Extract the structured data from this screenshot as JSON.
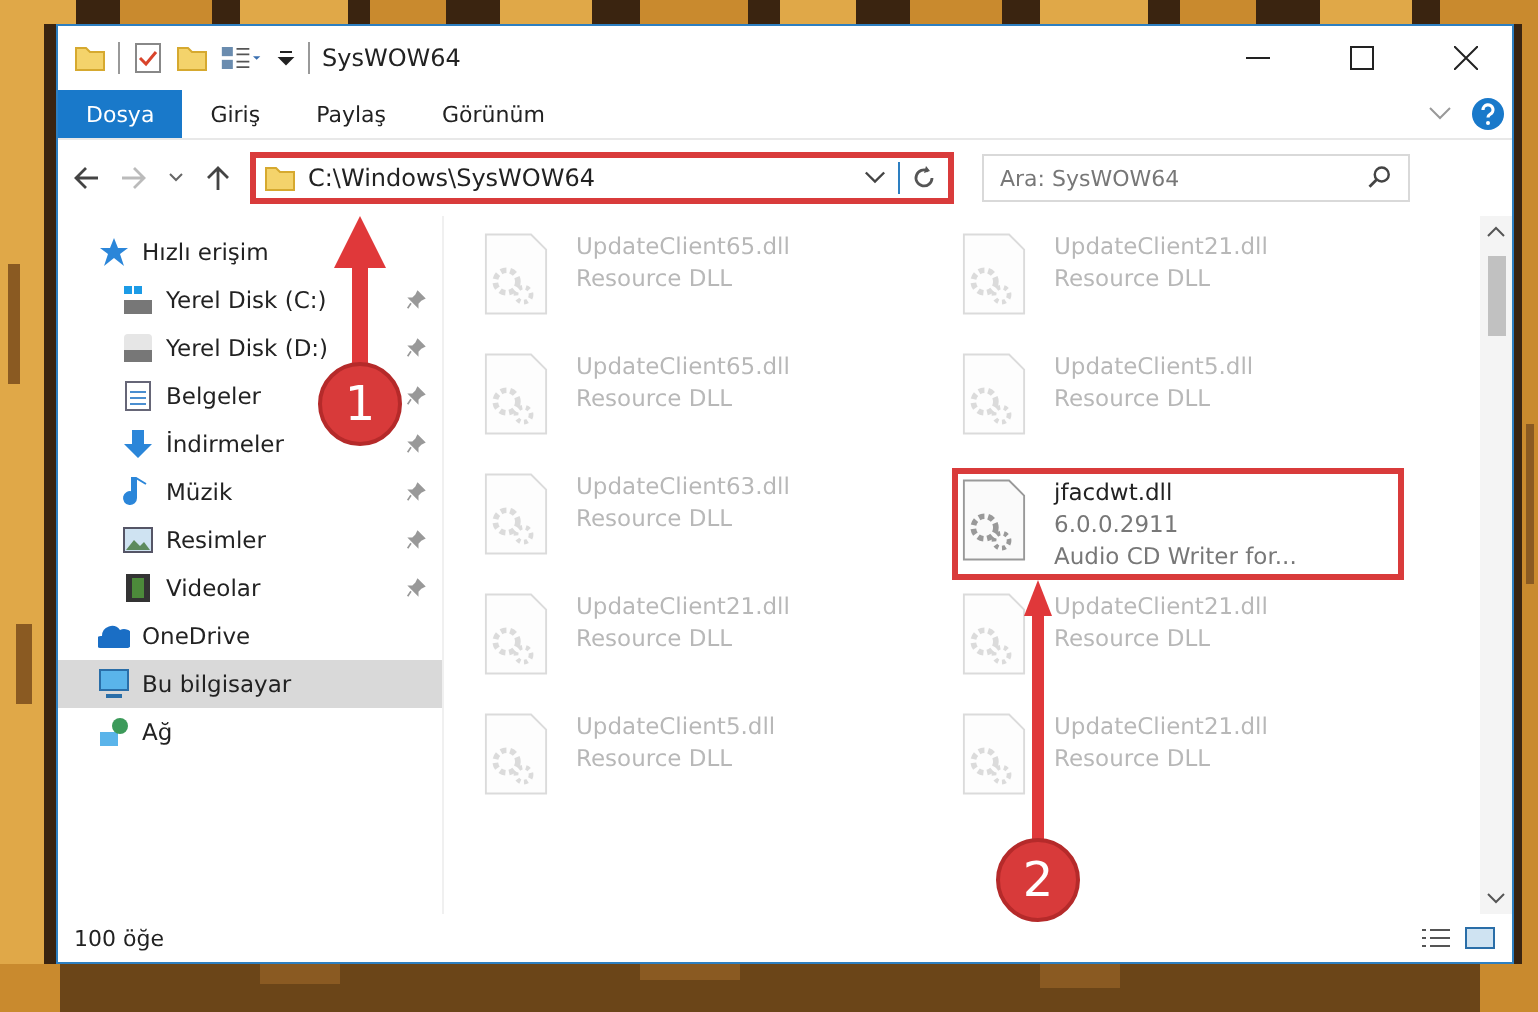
{
  "window": {
    "title": "SysWOW64"
  },
  "ribbon_tabs": [
    {
      "label": "Dosya",
      "selected": true
    },
    {
      "label": "Giriş",
      "selected": false
    },
    {
      "label": "Paylaş",
      "selected": false
    },
    {
      "label": "Görünüm",
      "selected": false
    }
  ],
  "address_bar": {
    "path": "C:\\Windows\\SysWOW64",
    "highlighted": true
  },
  "search": {
    "placeholder": "Ara: SysWOW64"
  },
  "sidebar": {
    "items": [
      {
        "label": "Hızlı erişim",
        "selected": false,
        "children": [
          {
            "label": "Yerel Disk (C:)",
            "pinned": true
          },
          {
            "label": "Yerel Disk (D:)",
            "pinned": true
          },
          {
            "label": "Belgeler",
            "pinned": true
          },
          {
            "label": "İndirmeler",
            "pinned": true
          },
          {
            "label": "Müzik",
            "pinned": true
          },
          {
            "label": "Resimler",
            "pinned": true
          },
          {
            "label": "Videolar",
            "pinned": true
          }
        ]
      },
      {
        "label": "OneDrive",
        "selected": false
      },
      {
        "label": "Bu bilgisayar",
        "selected": true
      },
      {
        "label": "Ağ",
        "selected": false
      }
    ]
  },
  "files": [
    {
      "name": "UpdateClient65.dll",
      "lines": [
        "Resource DLL"
      ],
      "faded": true,
      "highlighted": false
    },
    {
      "name": "UpdateClient21.dll",
      "lines": [
        "Resource DLL"
      ],
      "faded": true,
      "highlighted": false
    },
    {
      "name": "UpdateClient65.dll",
      "lines": [
        "Resource DLL"
      ],
      "faded": true,
      "highlighted": false
    },
    {
      "name": "UpdateClient5.dll",
      "lines": [
        "Resource DLL"
      ],
      "faded": true,
      "highlighted": false
    },
    {
      "name": "UpdateClient63.dll",
      "lines": [
        "Resource DLL"
      ],
      "faded": true,
      "highlighted": false
    },
    {
      "name": "jfacdwt.dll",
      "lines": [
        "6.0.0.2911",
        "Audio CD Writer for..."
      ],
      "faded": false,
      "highlighted": true
    },
    {
      "name": "UpdateClient21.dll",
      "lines": [
        "Resource DLL"
      ],
      "faded": true,
      "highlighted": false
    },
    {
      "name": "UpdateClient21.dll",
      "lines": [
        "Resource DLL"
      ],
      "faded": true,
      "highlighted": false
    },
    {
      "name": "UpdateClient5.dll",
      "lines": [
        "Resource DLL"
      ],
      "faded": true,
      "highlighted": false
    },
    {
      "name": "UpdateClient21.dll",
      "lines": [
        "Resource DLL"
      ],
      "faded": true,
      "highlighted": false
    }
  ],
  "status_bar": {
    "count": "100 öğe"
  },
  "annotations": [
    {
      "number": "1"
    },
    {
      "number": "2"
    }
  ]
}
